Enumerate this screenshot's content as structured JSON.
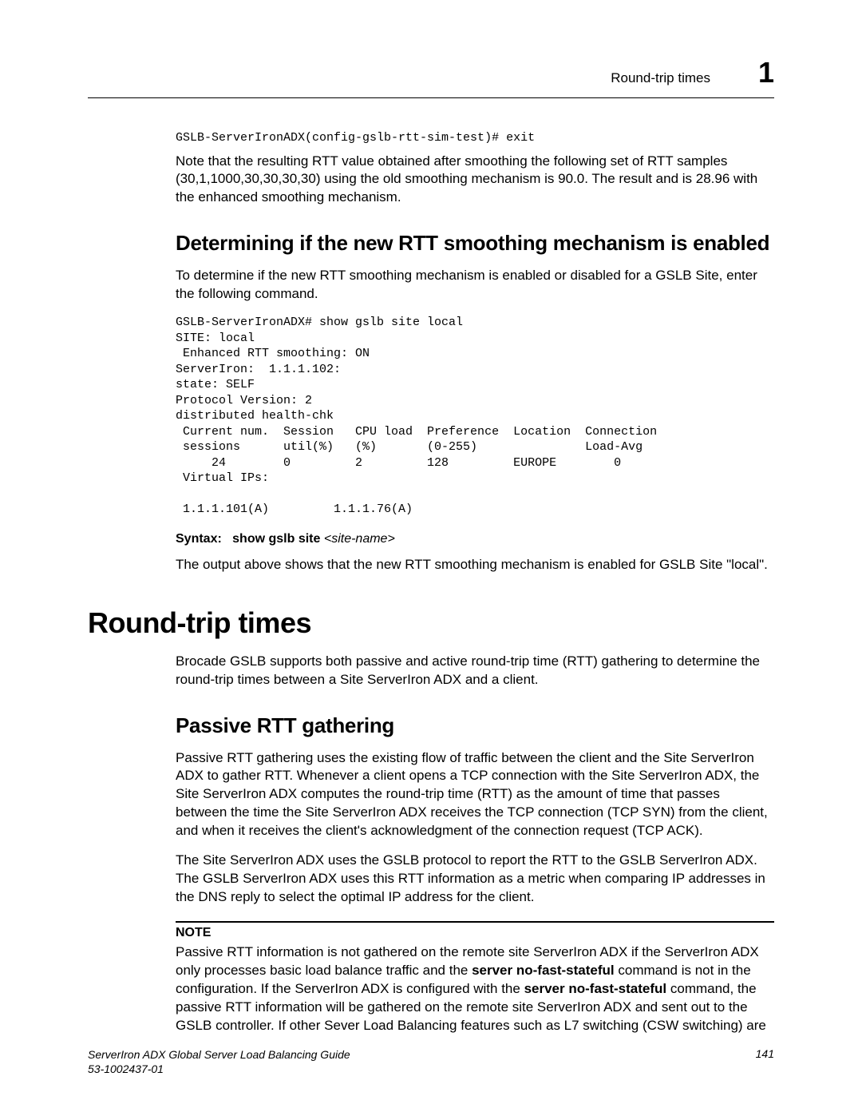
{
  "header": {
    "section_title": "Round-trip times",
    "chapter_number": "1"
  },
  "code_top": "GSLB-ServerIronADX(config-gslb-rtt-sim-test)# exit",
  "para_top": "Note that the resulting RTT value obtained after smoothing the following set of RTT samples (30,1,1000,30,30,30,30) using the old smoothing mechanism is 90.0. The result and is 28.96 with the enhanced smoothing mechanism.",
  "h2_determining": "Determining if the new RTT smoothing mechanism is enabled",
  "para_determining": "To determine if the new RTT smoothing mechanism is enabled or disabled for a GSLB Site, enter the following command.",
  "code_block": "GSLB-ServerIronADX# show gslb site local\nSITE: local\n Enhanced RTT smoothing: ON\nServerIron:  1.1.1.102:\nstate: SELF\nProtocol Version: 2\ndistributed health-chk\n Current num.  Session   CPU load  Preference  Location  Connection\n sessions      util(%)   (%)       (0-255)               Load-Avg\n     24        0         2         128         EUROPE        0\n Virtual IPs:\n\n 1.1.1.101(A)         1.1.1.76(A)",
  "syntax": {
    "label": "Syntax:",
    "bold": "show gslb site",
    "ital": "<site-name>"
  },
  "para_output": "The output above shows that the new RTT smoothing mechanism is enabled for GSLB Site \"local\".",
  "h1_rtt": "Round-trip times",
  "para_rtt_intro": "Brocade GSLB supports both passive and active round-trip time (RTT) gathering to determine the round-trip times between a Site ServerIron ADX and a client.",
  "h2_passive": "Passive RTT gathering",
  "para_passive_1": "Passive RTT gathering uses the existing flow of traffic between the client and the Site ServerIron ADX to gather RTT. Whenever a client opens a TCP connection with the Site ServerIron ADX, the Site ServerIron ADX computes the round-trip time (RTT) as the amount of time that passes between the time the Site ServerIron ADX receives the TCP connection (TCP SYN) from the client, and when it receives the client's acknowledgment of the connection request (TCP ACK).",
  "para_passive_2": "The Site ServerIron ADX uses the GSLB protocol to report the RTT to the GSLB ServerIron ADX. The GSLB ServerIron ADX uses this RTT information as a metric when comparing IP addresses in the DNS reply to select the optimal IP address for the client.",
  "note": {
    "label": "NOTE",
    "before1": "Passive RTT information is not gathered on the remote site ServerIron ADX if the ServerIron ADX only processes basic load balance traffic and the ",
    "cmd1": "server no-fast-stateful",
    "mid1": " command is not in the configuration. If the ServerIron ADX is configured with the ",
    "cmd2": "server no-fast-stateful",
    "after1": " command, the passive RTT information will be gathered on the remote site ServerIron ADX and sent out to the GSLB controller. If other Sever Load Balancing features such as L7 switching (CSW switching) are"
  },
  "footer": {
    "book": "ServerIron ADX Global Server Load Balancing Guide",
    "docnum": "53-1002437-01",
    "page": "141"
  }
}
